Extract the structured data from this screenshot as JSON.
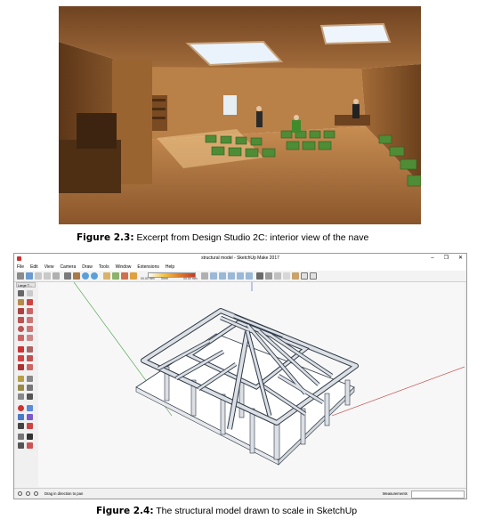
{
  "figure1": {
    "caption_label": "Figure 2.3:",
    "caption_text": "Excerpt from Design Studio 2C: interior view of the nave"
  },
  "figure2": {
    "caption_label": "Figure 2.4:",
    "caption_text": "The structural model drawn to scale in SketchUp"
  },
  "app": {
    "title": "structural model - SketchUp Make 2017",
    "window_controls": [
      "–",
      "❐",
      "✕"
    ],
    "menu": [
      "File",
      "Edit",
      "View",
      "Camera",
      "Draw",
      "Tools",
      "Window",
      "Extensions",
      "Help"
    ],
    "toolbar_labels": [
      "00.00 mm",
      "0mm",
      "00.00 mm"
    ],
    "large_tool_set_label": "Large T...",
    "status_text": "Drag in direction to pan",
    "measurements_label": "Measurements",
    "measurements_value": ""
  },
  "colors": {
    "wood": "#b0773f",
    "beam": "#dcdfe4",
    "beam_edge": "#2d3a48",
    "axis_green": "#3c9a3c",
    "axis_red": "#c03030",
    "axis_blue": "#3050c0",
    "chair": "#4e8c36"
  }
}
